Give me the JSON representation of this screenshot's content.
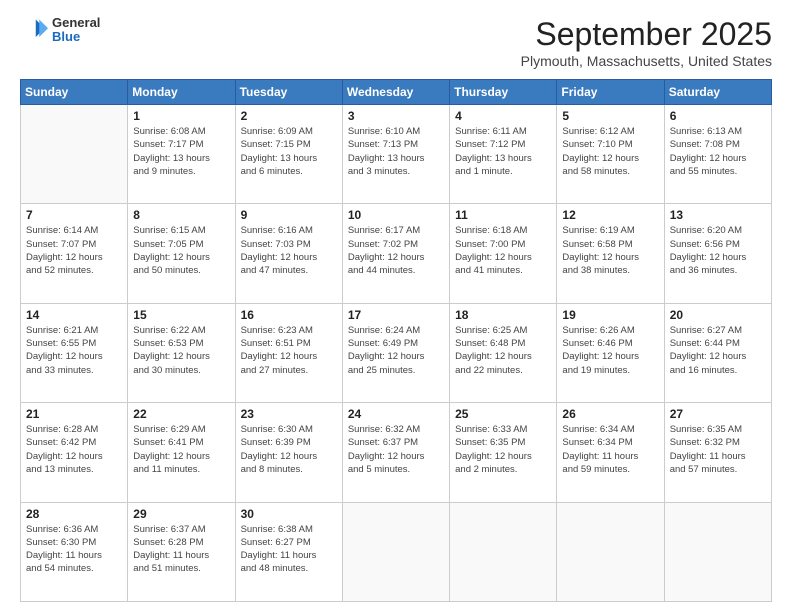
{
  "logo": {
    "general": "General",
    "blue": "Blue"
  },
  "header": {
    "month": "September 2025",
    "location": "Plymouth, Massachusetts, United States"
  },
  "weekdays": [
    "Sunday",
    "Monday",
    "Tuesday",
    "Wednesday",
    "Thursday",
    "Friday",
    "Saturday"
  ],
  "weeks": [
    [
      {
        "day": "",
        "info": ""
      },
      {
        "day": "1",
        "info": "Sunrise: 6:08 AM\nSunset: 7:17 PM\nDaylight: 13 hours\nand 9 minutes."
      },
      {
        "day": "2",
        "info": "Sunrise: 6:09 AM\nSunset: 7:15 PM\nDaylight: 13 hours\nand 6 minutes."
      },
      {
        "day": "3",
        "info": "Sunrise: 6:10 AM\nSunset: 7:13 PM\nDaylight: 13 hours\nand 3 minutes."
      },
      {
        "day": "4",
        "info": "Sunrise: 6:11 AM\nSunset: 7:12 PM\nDaylight: 13 hours\nand 1 minute."
      },
      {
        "day": "5",
        "info": "Sunrise: 6:12 AM\nSunset: 7:10 PM\nDaylight: 12 hours\nand 58 minutes."
      },
      {
        "day": "6",
        "info": "Sunrise: 6:13 AM\nSunset: 7:08 PM\nDaylight: 12 hours\nand 55 minutes."
      }
    ],
    [
      {
        "day": "7",
        "info": "Sunrise: 6:14 AM\nSunset: 7:07 PM\nDaylight: 12 hours\nand 52 minutes."
      },
      {
        "day": "8",
        "info": "Sunrise: 6:15 AM\nSunset: 7:05 PM\nDaylight: 12 hours\nand 50 minutes."
      },
      {
        "day": "9",
        "info": "Sunrise: 6:16 AM\nSunset: 7:03 PM\nDaylight: 12 hours\nand 47 minutes."
      },
      {
        "day": "10",
        "info": "Sunrise: 6:17 AM\nSunset: 7:02 PM\nDaylight: 12 hours\nand 44 minutes."
      },
      {
        "day": "11",
        "info": "Sunrise: 6:18 AM\nSunset: 7:00 PM\nDaylight: 12 hours\nand 41 minutes."
      },
      {
        "day": "12",
        "info": "Sunrise: 6:19 AM\nSunset: 6:58 PM\nDaylight: 12 hours\nand 38 minutes."
      },
      {
        "day": "13",
        "info": "Sunrise: 6:20 AM\nSunset: 6:56 PM\nDaylight: 12 hours\nand 36 minutes."
      }
    ],
    [
      {
        "day": "14",
        "info": "Sunrise: 6:21 AM\nSunset: 6:55 PM\nDaylight: 12 hours\nand 33 minutes."
      },
      {
        "day": "15",
        "info": "Sunrise: 6:22 AM\nSunset: 6:53 PM\nDaylight: 12 hours\nand 30 minutes."
      },
      {
        "day": "16",
        "info": "Sunrise: 6:23 AM\nSunset: 6:51 PM\nDaylight: 12 hours\nand 27 minutes."
      },
      {
        "day": "17",
        "info": "Sunrise: 6:24 AM\nSunset: 6:49 PM\nDaylight: 12 hours\nand 25 minutes."
      },
      {
        "day": "18",
        "info": "Sunrise: 6:25 AM\nSunset: 6:48 PM\nDaylight: 12 hours\nand 22 minutes."
      },
      {
        "day": "19",
        "info": "Sunrise: 6:26 AM\nSunset: 6:46 PM\nDaylight: 12 hours\nand 19 minutes."
      },
      {
        "day": "20",
        "info": "Sunrise: 6:27 AM\nSunset: 6:44 PM\nDaylight: 12 hours\nand 16 minutes."
      }
    ],
    [
      {
        "day": "21",
        "info": "Sunrise: 6:28 AM\nSunset: 6:42 PM\nDaylight: 12 hours\nand 13 minutes."
      },
      {
        "day": "22",
        "info": "Sunrise: 6:29 AM\nSunset: 6:41 PM\nDaylight: 12 hours\nand 11 minutes."
      },
      {
        "day": "23",
        "info": "Sunrise: 6:30 AM\nSunset: 6:39 PM\nDaylight: 12 hours\nand 8 minutes."
      },
      {
        "day": "24",
        "info": "Sunrise: 6:32 AM\nSunset: 6:37 PM\nDaylight: 12 hours\nand 5 minutes."
      },
      {
        "day": "25",
        "info": "Sunrise: 6:33 AM\nSunset: 6:35 PM\nDaylight: 12 hours\nand 2 minutes."
      },
      {
        "day": "26",
        "info": "Sunrise: 6:34 AM\nSunset: 6:34 PM\nDaylight: 11 hours\nand 59 minutes."
      },
      {
        "day": "27",
        "info": "Sunrise: 6:35 AM\nSunset: 6:32 PM\nDaylight: 11 hours\nand 57 minutes."
      }
    ],
    [
      {
        "day": "28",
        "info": "Sunrise: 6:36 AM\nSunset: 6:30 PM\nDaylight: 11 hours\nand 54 minutes."
      },
      {
        "day": "29",
        "info": "Sunrise: 6:37 AM\nSunset: 6:28 PM\nDaylight: 11 hours\nand 51 minutes."
      },
      {
        "day": "30",
        "info": "Sunrise: 6:38 AM\nSunset: 6:27 PM\nDaylight: 11 hours\nand 48 minutes."
      },
      {
        "day": "",
        "info": ""
      },
      {
        "day": "",
        "info": ""
      },
      {
        "day": "",
        "info": ""
      },
      {
        "day": "",
        "info": ""
      }
    ]
  ]
}
